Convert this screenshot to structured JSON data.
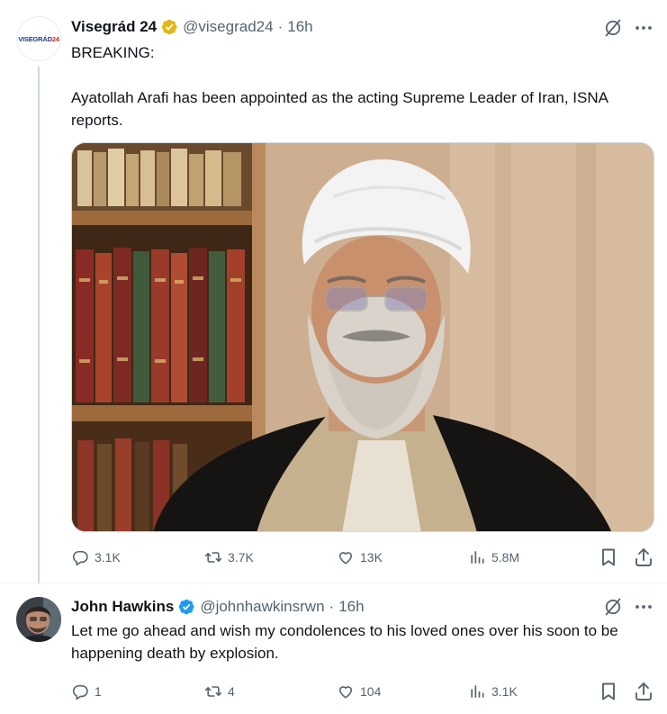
{
  "tweets": [
    {
      "name": "Visegrád 24",
      "handle": "@visegrad24",
      "separator": "·",
      "time": "16h",
      "avatar_text_blue": "VISEGRÁD",
      "avatar_text_red": "24",
      "text": "BREAKING:\n\nAyatollah Arafi has been appointed as the acting Supreme Leader of Iran, ISNA reports.",
      "stats": {
        "replies": "3.1K",
        "reposts": "3.7K",
        "likes": "13K",
        "views": "5.8M"
      }
    },
    {
      "name": "John Hawkins",
      "handle": "@johnhawkinsrwn",
      "separator": "·",
      "time": "16h",
      "text": "Let me go ahead and wish my condolences to his loved ones over his soon to be happening death by explosion.",
      "stats": {
        "replies": "1",
        "reposts": "4",
        "likes": "104",
        "views": "3.1K"
      }
    }
  ],
  "colors": {
    "gold_badge": "#e2b719",
    "blue_badge": "#1d9bf0",
    "secondary_text": "#536471",
    "primary_text": "#0f1419",
    "thread_line": "#cfd9de"
  },
  "icons": [
    "grok-icon",
    "more-icon",
    "reply-icon",
    "repost-icon",
    "like-icon",
    "views-icon",
    "bookmark-icon",
    "share-icon"
  ]
}
